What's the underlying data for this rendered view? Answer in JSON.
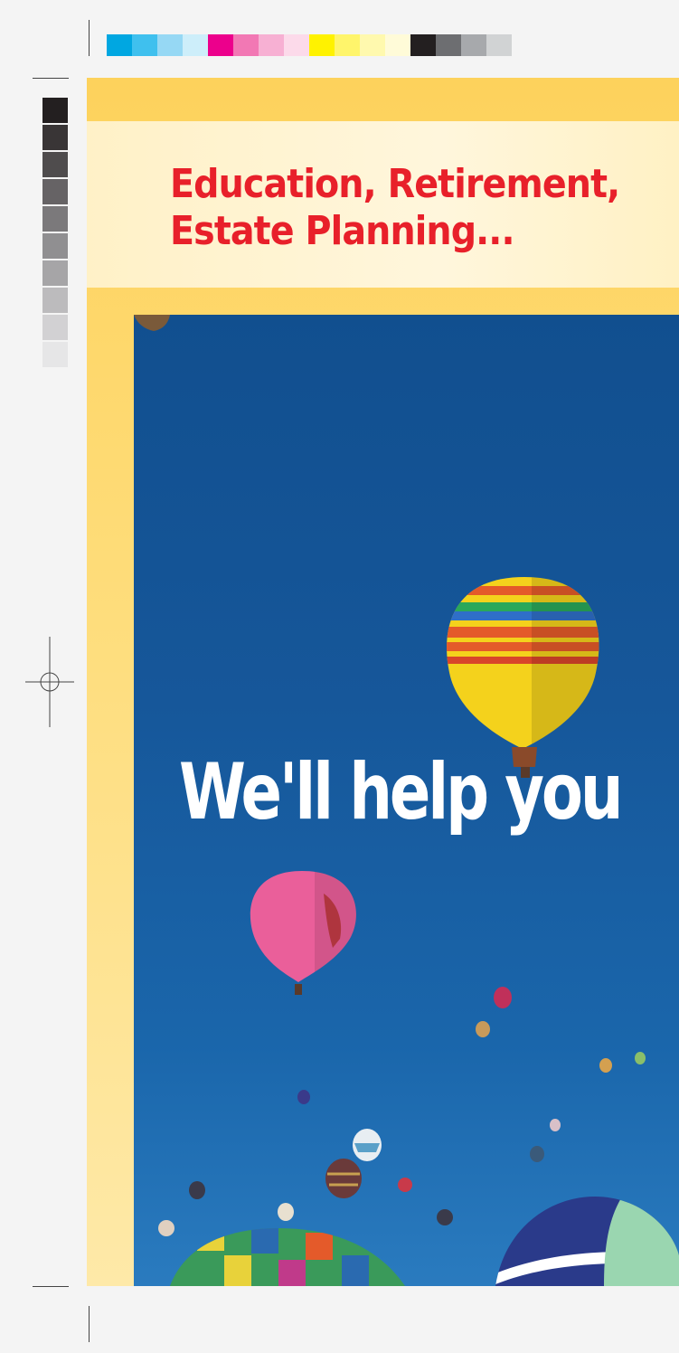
{
  "brochure": {
    "headline": "Education, Retirement,\nEstate Planning...",
    "tagline": "We'll help you"
  },
  "colors": {
    "headline": "#e8202a",
    "tagline": "#ffffff",
    "panel_yellow": "#fdd25c",
    "sky_blue": "#16579a"
  },
  "print_marks": {
    "color_swatches": [
      "#00a7e1",
      "#3fc0ee",
      "#96d8f4",
      "#cdeefa",
      "#ec008c",
      "#f278b4",
      "#f7b0d3",
      "#fcdaea",
      "#fff200",
      "#fff56b",
      "#fff9ae",
      "#fffbd8",
      "#231f20",
      "#6d6e71",
      "#a7a9ac",
      "#d1d3d4"
    ],
    "gray_swatches": [
      "#231f20",
      "#393536",
      "#4f4c4d",
      "#666365",
      "#7b797b",
      "#908f91",
      "#a6a5a7",
      "#bcbbbd",
      "#d2d1d3",
      "#e6e6e7"
    ]
  }
}
